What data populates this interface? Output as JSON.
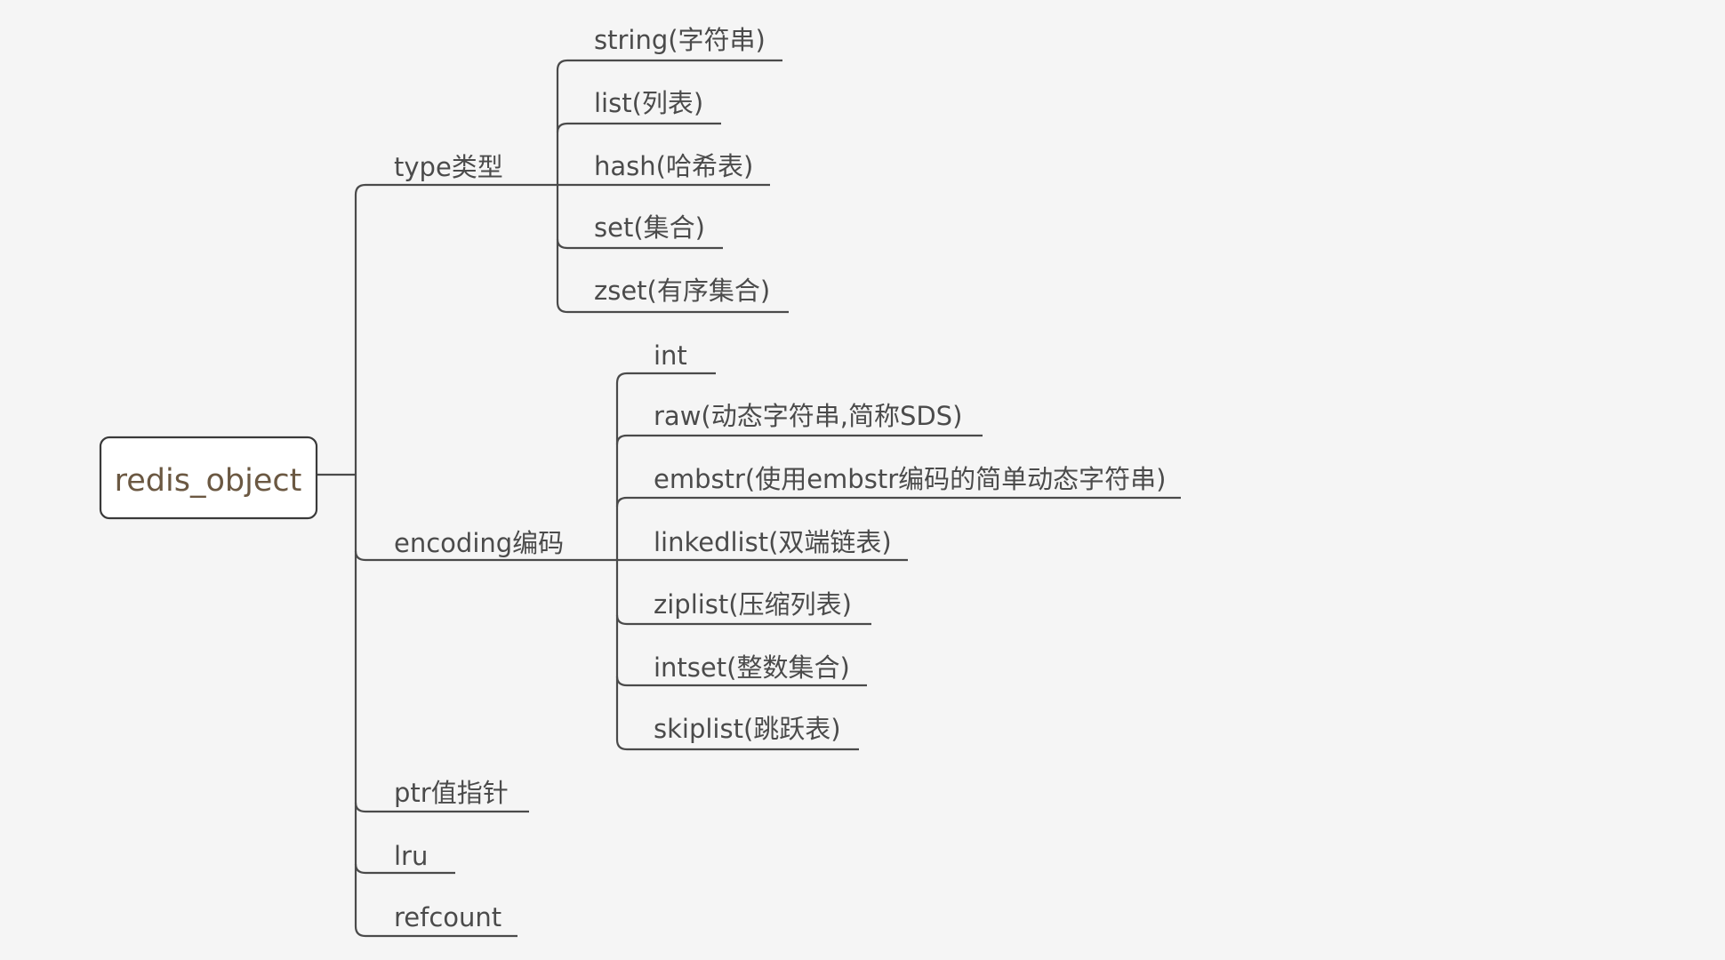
{
  "root": {
    "label": "redis_object"
  },
  "branches": [
    {
      "label": "type类型",
      "children": [
        "string(字符串)",
        "list(列表)",
        "hash(哈希表)",
        "set(集合)",
        "zset(有序集合)"
      ]
    },
    {
      "label": "encoding编码",
      "children": [
        "int",
        "raw(动态字符串,简称SDS)",
        "embstr(使用embstr编码的简单动态字符串)",
        "linkedlist(双端链表)",
        "ziplist(压缩列表)",
        "intset(整数集合)",
        "skiplist(跳跃表)"
      ]
    },
    {
      "label": "ptr值指针",
      "children": []
    },
    {
      "label": "lru",
      "children": []
    },
    {
      "label": "refcount",
      "children": []
    }
  ],
  "colors": {
    "background": "#f5f5f5",
    "line": "#4a4a4a",
    "text": "#4b4b4b",
    "root_text": "#6b5842",
    "root_fill": "#ffffff"
  }
}
